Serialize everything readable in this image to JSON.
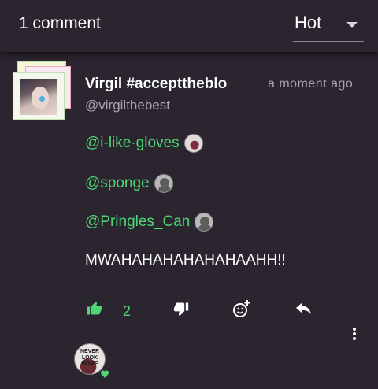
{
  "header": {
    "comment_count": "1 comment",
    "sort": {
      "selected": "Hot"
    }
  },
  "comment": {
    "username": "Virgil #accepttheblo",
    "handle": "@virgilthebest",
    "timestamp": "a moment ago",
    "mentions": [
      "@i-like-gloves",
      "@sponge",
      "@Pringles_Can"
    ],
    "text": "MWAHAHAHAHAHAHAAHH!!",
    "likes": "2"
  },
  "reply_avatar_text": "NEVER LOOK HOME",
  "colors": {
    "background": "#2b2530",
    "accent_green": "#4fd675",
    "muted_text": "#a9a3ae"
  },
  "icons": [
    "thumbs-up-icon",
    "thumbs-down-icon",
    "add-reaction-icon",
    "reply-icon",
    "more-vertical-icon",
    "heart-icon"
  ]
}
